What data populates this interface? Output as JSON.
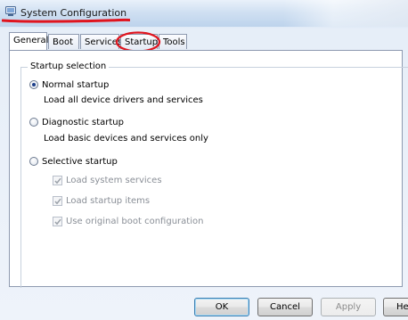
{
  "window": {
    "title": "System Configuration",
    "icon": "system-config-icon"
  },
  "tabs": [
    {
      "label": "General",
      "active": true
    },
    {
      "label": "Boot",
      "active": false
    },
    {
      "label": "Services",
      "active": false
    },
    {
      "label": "Startup",
      "active": false
    },
    {
      "label": "Tools",
      "active": false
    }
  ],
  "startup_selection": {
    "legend": "Startup selection",
    "normal": {
      "label": "Normal startup",
      "description": "Load all device drivers and services",
      "selected": true
    },
    "diagnostic": {
      "label": "Diagnostic startup",
      "description": "Load basic devices and services only",
      "selected": false
    },
    "selective": {
      "label": "Selective startup",
      "selected": false,
      "options": [
        {
          "label": "Load system services",
          "checked": true,
          "enabled": false
        },
        {
          "label": "Load startup items",
          "checked": true,
          "enabled": false
        },
        {
          "label": "Use original boot configuration",
          "checked": true,
          "enabled": false
        }
      ]
    }
  },
  "buttons": {
    "ok": "OK",
    "cancel": "Cancel",
    "apply": "Apply",
    "help": "Help"
  },
  "annotation_color": "#e0141e"
}
